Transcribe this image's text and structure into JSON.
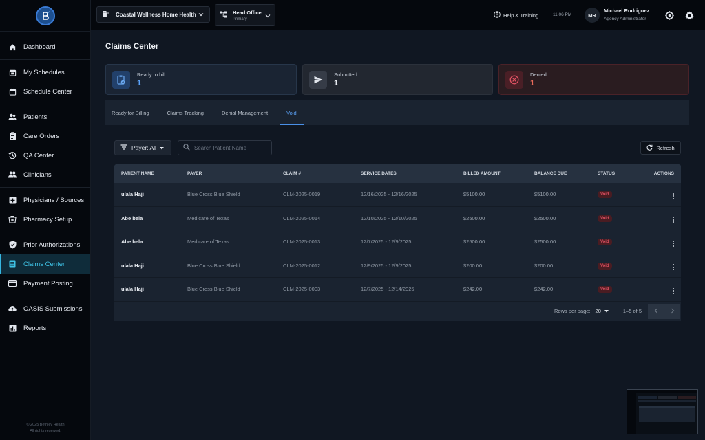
{
  "sidebar": {
    "items": [
      {
        "label": "Dashboard",
        "icon": "home-icon"
      },
      {
        "label": "My Schedules",
        "icon": "calendar-check-icon"
      },
      {
        "label": "Schedule Center",
        "icon": "calendar-icon"
      },
      {
        "label": "Patients",
        "icon": "users-icon"
      },
      {
        "label": "Care Orders",
        "icon": "clipboard-icon"
      },
      {
        "label": "QA Center",
        "icon": "history-icon"
      },
      {
        "label": "Clinicians",
        "icon": "people-icon"
      },
      {
        "label": "Physicians / Sources",
        "icon": "plus-box-icon"
      },
      {
        "label": "Pharmacy Setup",
        "icon": "pharmacy-icon"
      },
      {
        "label": "Prior Authorizations",
        "icon": "shield-check-icon"
      },
      {
        "label": "Claims Center",
        "icon": "document-icon"
      },
      {
        "label": "Payment Posting",
        "icon": "credit-card-icon"
      },
      {
        "label": "OASIS Submissions",
        "icon": "cloud-upload-icon"
      },
      {
        "label": "Reports",
        "icon": "bar-chart-icon"
      }
    ],
    "copyright_line1": "© 2025 Bethley Health",
    "copyright_line2": "All rights reserved."
  },
  "topbar": {
    "organization": "Coastal Wellness Home Health",
    "office_name": "Head Office",
    "office_type": "Primary",
    "help_label": "Help & Training",
    "time": "11:06 PM",
    "user_initials": "MR",
    "user_name": "Michael Rodriguez",
    "user_role": "Agency Administrator"
  },
  "page": {
    "title": "Claims Center"
  },
  "stats": {
    "ready": {
      "label": "Ready to bill",
      "value": "1"
    },
    "submitted": {
      "label": "Submitted",
      "value": "1"
    },
    "denied": {
      "label": "Denied",
      "value": "1"
    }
  },
  "tabs": [
    "Ready for Billing",
    "Claims Tracking",
    "Denial Management",
    "Void"
  ],
  "filters": {
    "payer_label": "Payer: All",
    "search_placeholder": "Search Patient Name",
    "refresh_label": "Refresh"
  },
  "table": {
    "columns": [
      "Patient Name",
      "Payer",
      "Claim #",
      "Service Dates",
      "Billed Amount",
      "Balance Due",
      "Status",
      "Actions"
    ],
    "rows": [
      {
        "patient": "ulala Haji",
        "payer": "Blue Cross Blue Shield",
        "claim": "CLM-2025-0019",
        "dates": "12/16/2025 - 12/16/2025",
        "billed": "$5100.00",
        "balance": "$5100.00",
        "status": "Void"
      },
      {
        "patient": "Abe bela",
        "payer": "Medicare of Texas",
        "claim": "CLM-2025-0014",
        "dates": "12/10/2025 - 12/10/2025",
        "billed": "$2500.00",
        "balance": "$2500.00",
        "status": "Void"
      },
      {
        "patient": "Abe bela",
        "payer": "Medicare of Texas",
        "claim": "CLM-2025-0013",
        "dates": "12/7/2025 - 12/9/2025",
        "billed": "$2500.00",
        "balance": "$2500.00",
        "status": "Void"
      },
      {
        "patient": "ulala Haji",
        "payer": "Blue Cross Blue Shield",
        "claim": "CLM-2025-0012",
        "dates": "12/9/2025 - 12/9/2025",
        "billed": "$200.00",
        "balance": "$200.00",
        "status": "Void"
      },
      {
        "patient": "ulala Haji",
        "payer": "Blue Cross Blue Shield",
        "claim": "CLM-2025-0003",
        "dates": "12/7/2025 - 12/14/2025",
        "billed": "$242.00",
        "balance": "$242.00",
        "status": "Void"
      }
    ],
    "rows_per_page_label": "Rows per page:",
    "rows_per_page": "20",
    "range": "1–5 of 5"
  },
  "colors": {
    "accent": "#4a90e8",
    "active_nav": "#3fc3e6",
    "denied": "#e05263",
    "background": "#101722"
  }
}
